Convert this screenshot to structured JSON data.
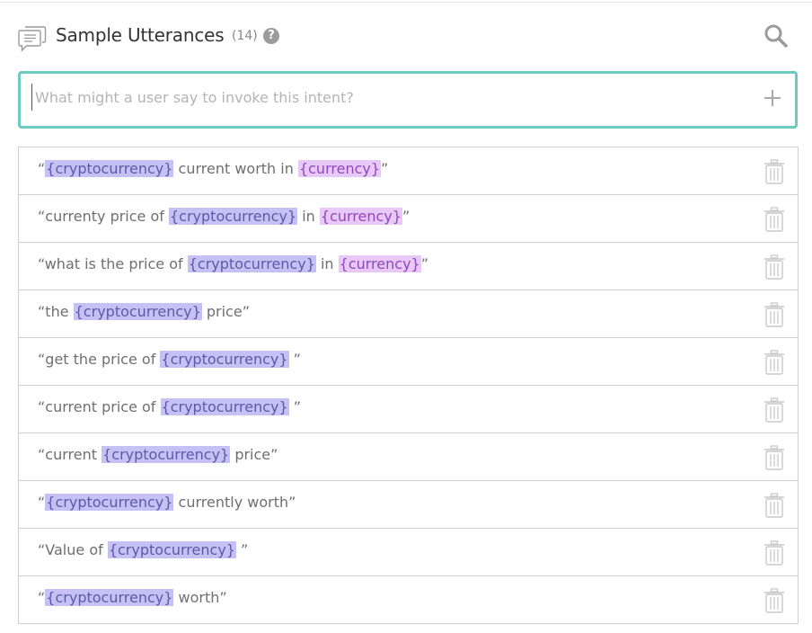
{
  "header": {
    "title": "Sample Utterances",
    "count": "(14)",
    "help": "?"
  },
  "input": {
    "placeholder": "What might a user say to invoke this intent?",
    "value": ""
  },
  "slot_colors": {
    "cryptocurrency": "#c5c1f5",
    "currency": "#e7c8f6"
  },
  "icons": [
    "chat-bubble-icon",
    "help-icon",
    "search-icon",
    "plus-icon",
    "trash-icon"
  ],
  "utterances": [
    [
      {
        "t": "“"
      },
      {
        "t": "{cryptocurrency}",
        "s": "c"
      },
      {
        "t": " current worth in "
      },
      {
        "t": "{currency}",
        "s": "r"
      },
      {
        "t": "”"
      }
    ],
    [
      {
        "t": "“currenty price of "
      },
      {
        "t": "{cryptocurrency}",
        "s": "c"
      },
      {
        "t": " in "
      },
      {
        "t": "{currency}",
        "s": "r"
      },
      {
        "t": "”"
      }
    ],
    [
      {
        "t": "“what is the price of "
      },
      {
        "t": "{cryptocurrency}",
        "s": "c"
      },
      {
        "t": " in "
      },
      {
        "t": "{currency}",
        "s": "r"
      },
      {
        "t": "”"
      }
    ],
    [
      {
        "t": "“the "
      },
      {
        "t": "{cryptocurrency}",
        "s": "c"
      },
      {
        "t": " price”"
      }
    ],
    [
      {
        "t": "“get the price of "
      },
      {
        "t": "{cryptocurrency}",
        "s": "c"
      },
      {
        "t": " ”"
      }
    ],
    [
      {
        "t": "“current price of "
      },
      {
        "t": "{cryptocurrency}",
        "s": "c"
      },
      {
        "t": " ”"
      }
    ],
    [
      {
        "t": "“current "
      },
      {
        "t": "{cryptocurrency}",
        "s": "c"
      },
      {
        "t": " price”"
      }
    ],
    [
      {
        "t": "“"
      },
      {
        "t": "{cryptocurrency}",
        "s": "c"
      },
      {
        "t": " currently worth”"
      }
    ],
    [
      {
        "t": "“Value of "
      },
      {
        "t": "{cryptocurrency}",
        "s": "c"
      },
      {
        "t": " ”"
      }
    ],
    [
      {
        "t": "“"
      },
      {
        "t": "{cryptocurrency}",
        "s": "c"
      },
      {
        "t": " worth”"
      }
    ]
  ]
}
